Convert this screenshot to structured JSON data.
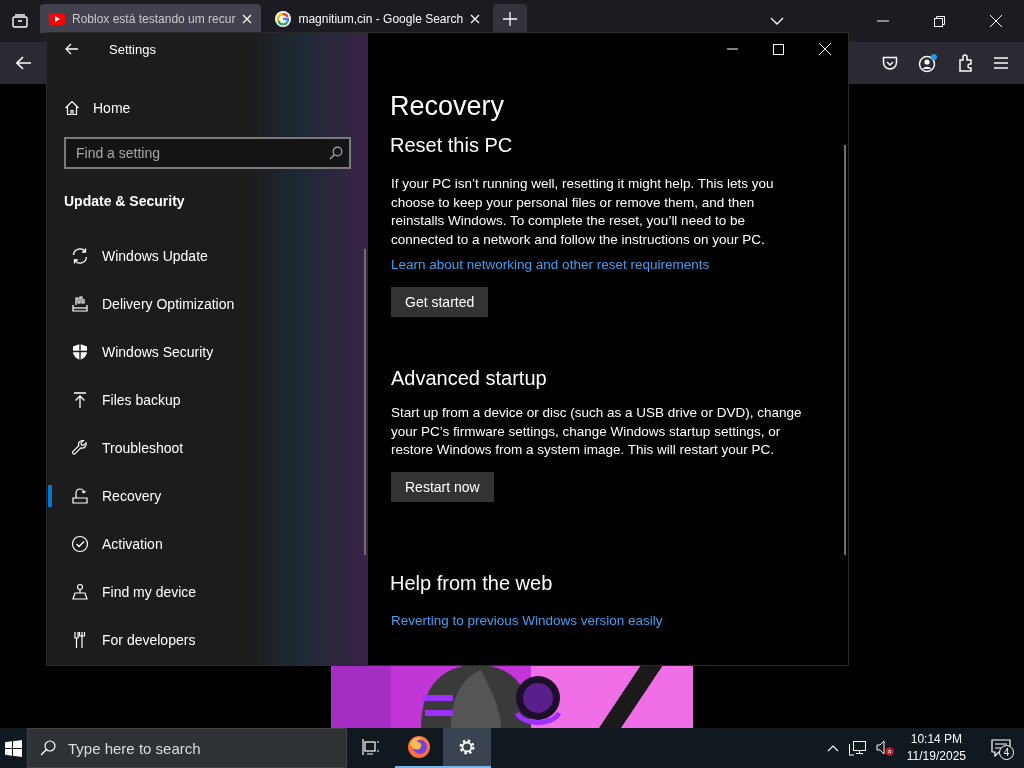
{
  "browser": {
    "tabs": [
      {
        "kind": "video",
        "title": "Roblox está testando um recur",
        "selected": true
      },
      {
        "kind": "search",
        "title": "magnitium,cin - Google Search",
        "selected": false
      }
    ]
  },
  "settings": {
    "title": "Settings",
    "home": "Home",
    "search": {
      "placeholder": "Find a setting"
    },
    "section": "Update & Security",
    "items": [
      {
        "kind": "update",
        "label": "Windows Update",
        "selected": false
      },
      {
        "kind": "delivery",
        "label": "Delivery Optimization",
        "selected": false
      },
      {
        "kind": "shield",
        "label": "Windows Security",
        "selected": false
      },
      {
        "kind": "backup",
        "label": "Files backup",
        "selected": false
      },
      {
        "kind": "wrench",
        "label": "Troubleshoot",
        "selected": false
      },
      {
        "kind": "recovery",
        "label": "Recovery",
        "selected": true
      },
      {
        "kind": "activation",
        "label": "Activation",
        "selected": false
      },
      {
        "kind": "find",
        "label": "Find my device",
        "selected": false
      },
      {
        "kind": "developers",
        "label": "For developers",
        "selected": false
      }
    ],
    "page_title": "Recovery",
    "sections": [
      {
        "title": "Reset this PC",
        "text": "If your PC isn’t running well, resetting it might help. This lets you choose to keep your personal files or remove them, and then reinstalls Windows. To complete the reset, you’ll need to be connected to a network and follow the instructions on your PC.",
        "link": "Learn about networking and other reset requirements",
        "button": "Get started"
      },
      {
        "title": "Advanced startup",
        "text": "Start up from a device or disc (such as a USB drive or DVD), change your PC’s firmware settings, change Windows startup settings, or restore Windows from a system image. This will restart your PC.",
        "button": "Restart now"
      },
      {
        "title": "Help from the web",
        "link": "Reverting to previous Windows version easily"
      }
    ]
  },
  "taskbar": {
    "search": {
      "placeholder": "Type here to search"
    },
    "apps": [
      {
        "kind": "taskview",
        "open": false,
        "selected": false
      },
      {
        "kind": "firefox",
        "open": true,
        "selected": false
      },
      {
        "kind": "settings",
        "open": true,
        "selected": true
      }
    ],
    "time": "10:14 PM",
    "date": "11/19/2025",
    "notifications": "4"
  }
}
